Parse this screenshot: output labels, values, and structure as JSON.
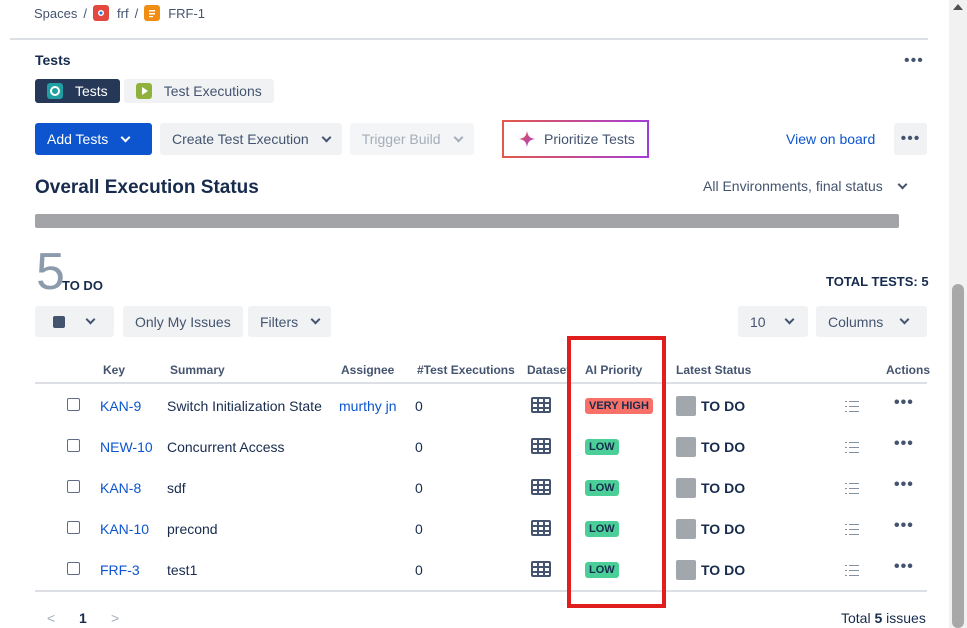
{
  "breadcrumb": {
    "root": "Spaces",
    "space": "frf",
    "issue": "FRF-1"
  },
  "section": {
    "title": "Tests",
    "more": "•••"
  },
  "tabs": [
    {
      "label": "Tests",
      "active": true,
      "icon": "tests-icon"
    },
    {
      "label": "Test Executions",
      "active": false,
      "icon": "test-executions-icon"
    }
  ],
  "toolbar": {
    "add_tests": "Add Tests",
    "create_execution": "Create Test Execution",
    "trigger_build": "Trigger Build",
    "prioritize": "Prioritize Tests",
    "view_board": "View on board",
    "more": "•••"
  },
  "status": {
    "title": "Overall Execution Status",
    "env_filter": "All Environments, final status",
    "count": "5",
    "count_label": "TO DO",
    "total_tests": "TOTAL TESTS: 5"
  },
  "filters": {
    "only_my_issues": "Only My Issues",
    "filters": "Filters",
    "page_size": "10",
    "columns": "Columns"
  },
  "table": {
    "headers": {
      "key": "Key",
      "summary": "Summary",
      "assignee": "Assignee",
      "test_executions": "#Test Executions",
      "dataset": "Dataset",
      "ai_priority": "AI Priority",
      "latest_status": "Latest Status",
      "actions": "Actions"
    },
    "rows": [
      {
        "key": "KAN-9",
        "summary": "Switch Initialization State",
        "assignee": "murthy jn",
        "executions": "0",
        "priority": "VERY HIGH",
        "status": "TO DO"
      },
      {
        "key": "NEW-10",
        "summary": "Concurrent Access",
        "assignee": "",
        "executions": "0",
        "priority": "LOW",
        "status": "TO DO"
      },
      {
        "key": "KAN-8",
        "summary": "sdf",
        "assignee": "",
        "executions": "0",
        "priority": "LOW",
        "status": "TO DO"
      },
      {
        "key": "KAN-10",
        "summary": "precond",
        "assignee": "",
        "executions": "0",
        "priority": "LOW",
        "status": "TO DO"
      },
      {
        "key": "FRF-3",
        "summary": "test1",
        "assignee": "",
        "executions": "0",
        "priority": "LOW",
        "status": "TO DO"
      }
    ]
  },
  "pagination": {
    "prev": "<",
    "page": "1",
    "next": ">",
    "total_prefix": "Total",
    "total_count": "5",
    "total_suffix": "issues"
  },
  "colors": {
    "primary": "#0c55cf",
    "very_high": "#f87168",
    "low": "#4bce97",
    "highlight": "#e01e1e"
  }
}
